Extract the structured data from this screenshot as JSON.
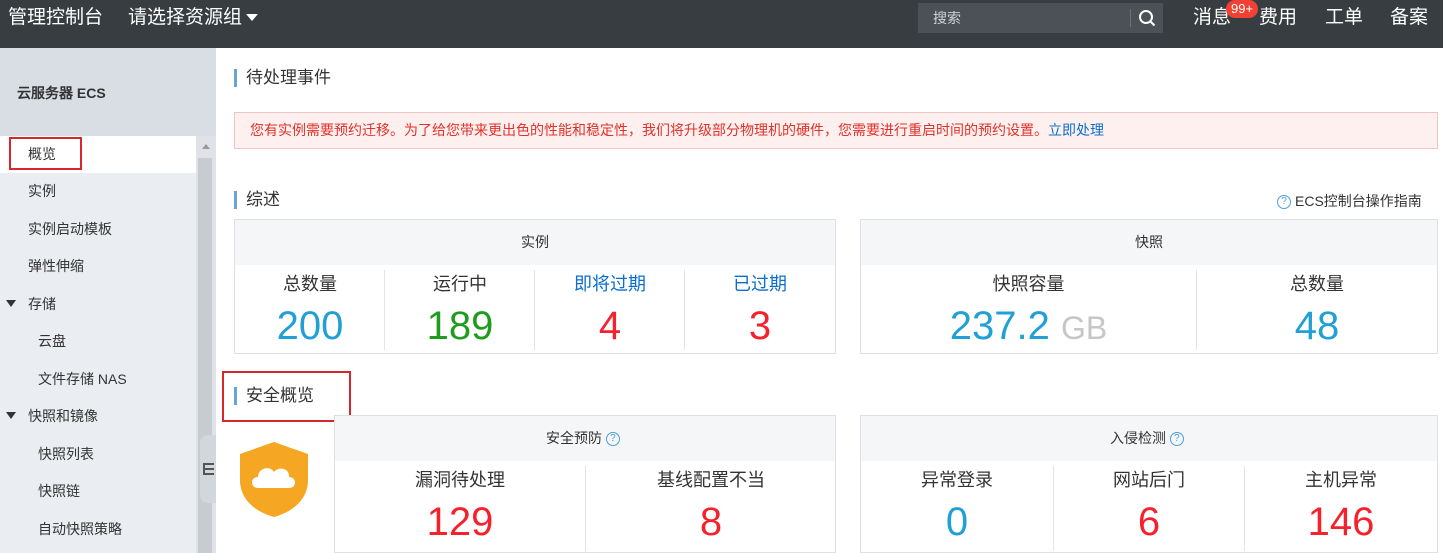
{
  "topbar": {
    "brand": "管理控制台",
    "resource_group": "请选择资源组",
    "search_placeholder": "搜索",
    "links": {
      "messages": "消息",
      "billing": "费用",
      "ticket": "工单",
      "filing": "备案"
    },
    "badge": "99+"
  },
  "sidebar": {
    "title": "云服务器 ECS",
    "items": [
      {
        "label": "概览"
      },
      {
        "label": "实例"
      },
      {
        "label": "实例启动模板"
      },
      {
        "label": "弹性伸缩"
      },
      {
        "label": "存储"
      },
      {
        "label": "云盘"
      },
      {
        "label": "文件存储 NAS"
      },
      {
        "label": "快照和镜像"
      },
      {
        "label": "快照列表"
      },
      {
        "label": "快照链"
      },
      {
        "label": "自动快照策略"
      }
    ]
  },
  "pending": {
    "title": "待处理事件",
    "alert_text": "您有实例需要预约迁移。为了给您带来更出色的性能和稳定性，我们将升级部分物理机的硬件，您需要进行重启时间的预约设置。",
    "alert_link": "立即处理"
  },
  "overview": {
    "title": "综述",
    "guide_link": "ECS控制台操作指南",
    "instances": {
      "header": "实例",
      "metrics": [
        {
          "label": "总数量",
          "value": "200"
        },
        {
          "label": "运行中",
          "value": "189"
        },
        {
          "label": "即将过期",
          "value": "4"
        },
        {
          "label": "已过期",
          "value": "3"
        }
      ]
    },
    "snapshots": {
      "header": "快照",
      "capacity_label": "快照容量",
      "capacity_value": "237.2",
      "capacity_unit": "GB",
      "count_label": "总数量",
      "count_value": "48"
    }
  },
  "security": {
    "title": "安全概览",
    "prevention": {
      "header": "安全预防",
      "metrics": [
        {
          "label": "漏洞待处理",
          "value": "129"
        },
        {
          "label": "基线配置不当",
          "value": "8"
        }
      ]
    },
    "intrusion": {
      "header": "入侵检测",
      "metrics": [
        {
          "label": "异常登录",
          "value": "0"
        },
        {
          "label": "网站后门",
          "value": "6"
        },
        {
          "label": "主机异常",
          "value": "146"
        }
      ]
    }
  },
  "colors": {
    "topbar_bg": "#373d41",
    "accent_blue": "#21a0d5",
    "running_green": "#1e9c1e",
    "alert_red": "#f5222d",
    "link_blue": "#0a6fcc",
    "shield_orange": "#f5a623"
  }
}
